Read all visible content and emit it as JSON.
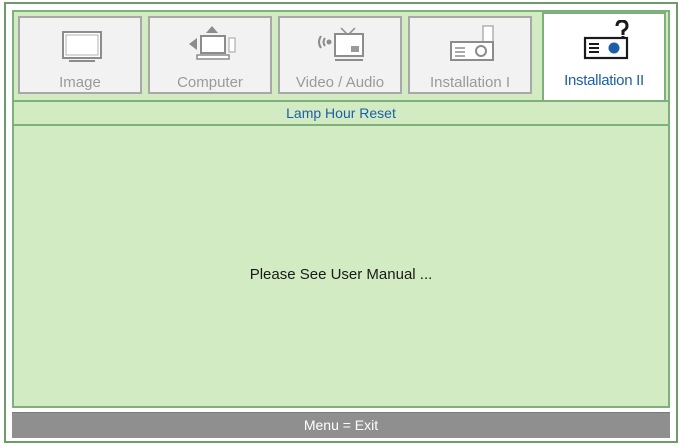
{
  "tabs": [
    {
      "label": "Image",
      "icon": "monitor-icon",
      "active": false
    },
    {
      "label": "Computer",
      "icon": "computer-icon",
      "active": false
    },
    {
      "label": "Video / Audio",
      "icon": "video-audio-icon",
      "active": false
    },
    {
      "label": "Installation I",
      "icon": "projector-icon",
      "active": false
    },
    {
      "label": "Installation II",
      "icon": "projector-help-icon",
      "active": true
    }
  ],
  "submenu": {
    "title": "Lamp Hour Reset"
  },
  "content": {
    "message": "Please See User Manual ..."
  },
  "footer": {
    "hint": "Menu = Exit"
  },
  "colors": {
    "panel_green": "#d3ebc3",
    "border_green": "#7eb07a",
    "active_text": "#1c5fa8",
    "inactive_text": "#9a9a9a",
    "footer_gray": "#8f8f8f"
  }
}
